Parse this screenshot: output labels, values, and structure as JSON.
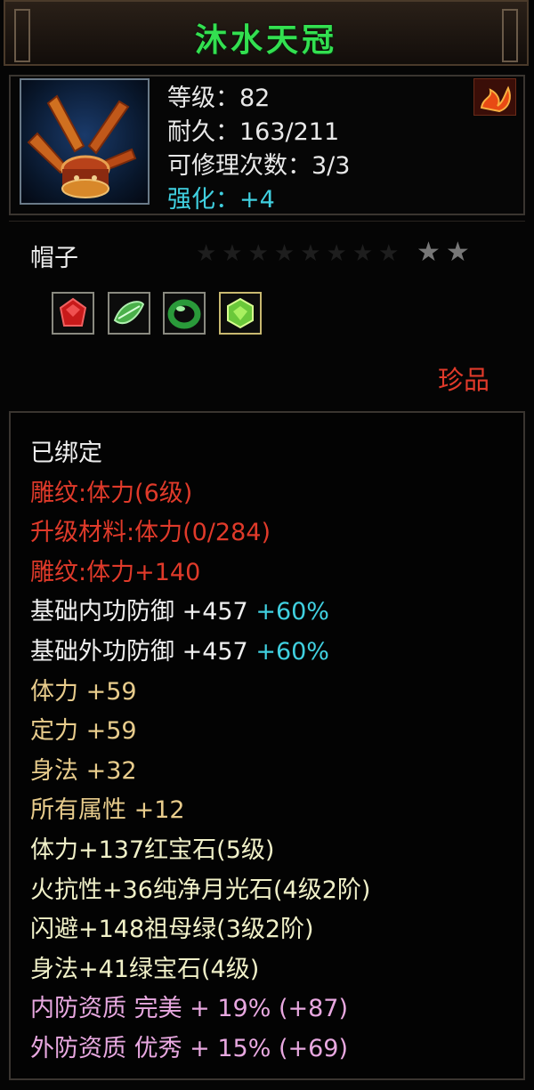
{
  "item": {
    "name": "沐水天冠",
    "stats": {
      "level": "等级：82",
      "durability": "耐久：163/211",
      "repair": "可修理次数：3/3",
      "enhance": "强化：+4"
    },
    "slot_type": "帽子",
    "stars": "★★",
    "rarity": "珍品",
    "icon": "helmet-icon",
    "badge_icon": "flame-badge-icon"
  },
  "gems": [
    {
      "icon": "red-gem-icon",
      "color": "#c81a1a"
    },
    {
      "icon": "green-leaf-gem-icon",
      "color": "#4ab04a"
    },
    {
      "icon": "jade-ring-gem-icon",
      "color": "#2a9a3a"
    },
    {
      "icon": "emerald-gem-icon",
      "color": "#6ac83a"
    }
  ],
  "attributes": [
    {
      "text": "已绑定",
      "color": "white"
    },
    {
      "text": "雕纹:体力(6级)",
      "color": "red"
    },
    {
      "text": "升级材料:体力(0/284)",
      "color": "red"
    },
    {
      "text": "雕纹:体力+140",
      "color": "red"
    },
    {
      "text": "基础内功防御 +457",
      "extra": " +60%",
      "color": "white"
    },
    {
      "text": "基础外功防御 +457",
      "extra": " +60%",
      "color": "white"
    },
    {
      "text": "体力 +59",
      "color": "gold"
    },
    {
      "text": "定力 +59",
      "color": "gold"
    },
    {
      "text": "身法 +32",
      "color": "gold"
    },
    {
      "text": "所有属性 +12",
      "color": "gold"
    },
    {
      "text": "体力+137红宝石(5级)",
      "color": "yellow"
    },
    {
      "text": "火抗性+36纯净月光石(4级2阶)",
      "color": "yellow"
    },
    {
      "text": "闪避+148祖母绿(3级2阶)",
      "color": "yellow"
    },
    {
      "text": "身法+41绿宝石(4级)",
      "color": "yellow"
    },
    {
      "text": "内防资质 完美 + 19% (+87)",
      "color": "pink"
    },
    {
      "text": "外防资质 优秀 + 15% (+69)",
      "color": "pink"
    }
  ],
  "colors": {
    "title_green": "#33e050",
    "enhance_cyan": "#40d0e0",
    "rarity_red": "#e03a2a",
    "attr_red": "#e03a2a",
    "attr_gold": "#e8cc8c",
    "attr_yellow": "#f0f0c8",
    "attr_pink": "#e8a8e0"
  }
}
